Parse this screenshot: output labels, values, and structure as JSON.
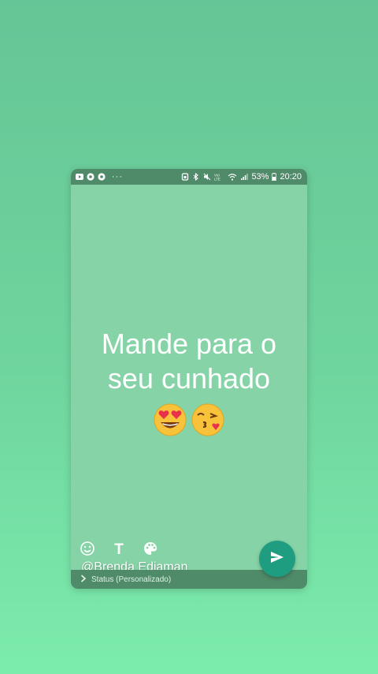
{
  "status_bar": {
    "left_icons": [
      "youtube-icon",
      "chrome-icon",
      "chrome-icon"
    ],
    "more": "···",
    "right_icons": [
      "alarm-icon",
      "bluetooth-icon",
      "mute-icon",
      "volte-icon",
      "wifi-icon",
      "signal-icon"
    ],
    "volte_label": "Vo) LTE",
    "battery": "53%",
    "time": "20:20"
  },
  "status_text": {
    "line1": "Mande para o",
    "line2": "seu cunhado"
  },
  "emojis": [
    "😍",
    "😘"
  ],
  "toolbar": {
    "emoji_icon": "smile-icon",
    "text_tool_label": "T",
    "palette_icon": "palette-icon"
  },
  "watermark": "@Brenda Ediaman",
  "caption": {
    "label": "Status (Personalizado)",
    "icon": "chevron-right-icon"
  },
  "send": {
    "icon": "send-icon"
  },
  "colors": {
    "background_top": "#66c596",
    "background_bottom": "#7cecac",
    "canvas": "#86d3a7",
    "bar": "#4f8a69",
    "send_button": "#1f9d80"
  }
}
